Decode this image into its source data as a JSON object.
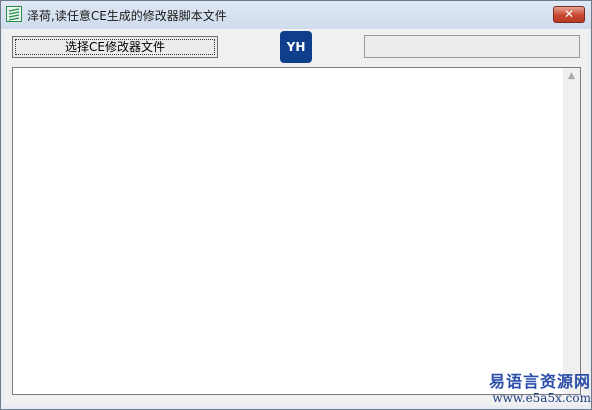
{
  "window": {
    "title": "泽荷,读任意CE生成的修改器脚本文件",
    "close_glyph": "✕"
  },
  "toolbar": {
    "select_button_label": "选择CE修改器文件",
    "logo_text": "YH",
    "path_value": ""
  },
  "editor": {
    "content": "",
    "scroll_up_glyph": "▲"
  },
  "watermark": {
    "chinese": "易语言资源网",
    "url": "www.e5a5x.com"
  },
  "colors": {
    "logo_bg": "#0f3f8c",
    "close_button": "#c8472f",
    "watermark": "#2b4ea8"
  }
}
